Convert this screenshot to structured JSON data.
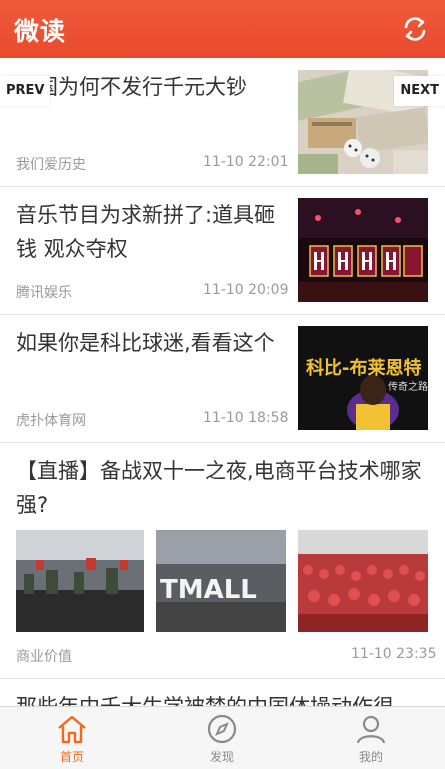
{
  "app": {
    "title": "微读"
  },
  "nav": {
    "prev": "PREV",
    "next": "NEXT"
  },
  "articles": [
    {
      "title": "韩国为何不发行千元大钞",
      "source": "我们爱历史",
      "time": "11-10 22:01"
    },
    {
      "title": "音乐节目为求新拼了:道具砸钱 观众夺权",
      "source": "腾讯娱乐",
      "time": "11-10 20:09"
    },
    {
      "title": "如果你是科比球迷,看看这个",
      "source": "虎扑体育网",
      "time": "11-10 18:58",
      "thumb_text": "科比-布莱恩特",
      "thumb_sub": "传奇之路"
    },
    {
      "title": "【直播】备战双十一之夜,电商平台技术哪家强?",
      "source": "商业价值",
      "time": "11-10 23:35",
      "thumb_text": "TMALL"
    },
    {
      "title": "那些年中千大生学被梦的中国体操动作很"
    }
  ],
  "tabs": [
    {
      "label": "首页",
      "icon": "home-icon",
      "active": true
    },
    {
      "label": "发现",
      "icon": "compass-icon",
      "active": false
    },
    {
      "label": "我的",
      "icon": "user-icon",
      "active": false
    }
  ],
  "colors": {
    "brand": "#e84a2c",
    "active_tab": "#ef6a1a"
  }
}
